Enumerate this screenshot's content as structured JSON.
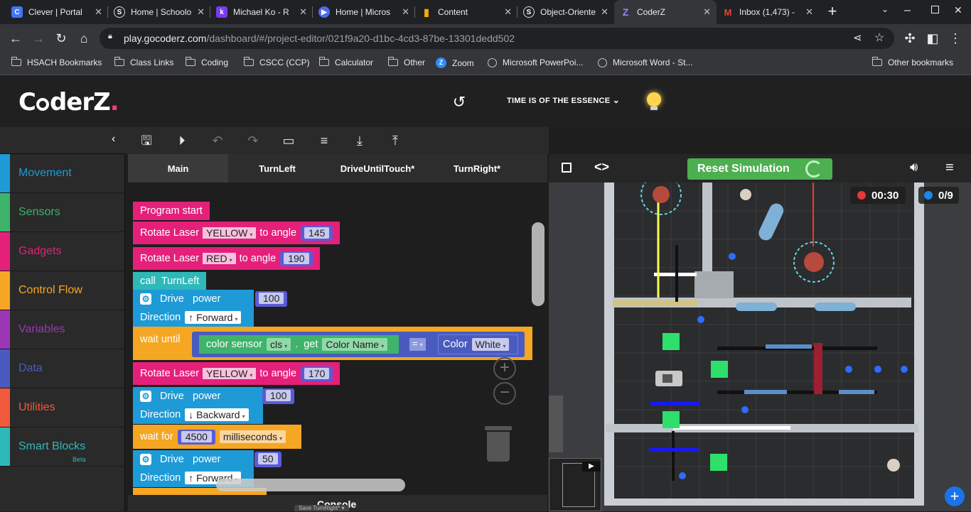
{
  "browser": {
    "tabs": [
      {
        "title": "Clever | Portal",
        "icon": "clever-favicon",
        "color": "#4274f6",
        "glyph": "C"
      },
      {
        "title": "Home | Schoolo",
        "icon": "schoology-favicon",
        "color": "#2a2a2a",
        "glyph": "S"
      },
      {
        "title": "Michael Ko - R",
        "icon": "kami-favicon",
        "color": "#7c3aed",
        "glyph": "k"
      },
      {
        "title": "Home | Micros",
        "icon": "copilot-favicon",
        "color": "#4f6bed",
        "glyph": "▶"
      },
      {
        "title": "Content",
        "icon": "chart-favicon",
        "color": "#2a2a2a",
        "glyph": "▮"
      },
      {
        "title": "Object-Oriente",
        "icon": "schoology-favicon",
        "color": "#2a2a2a",
        "glyph": "S"
      },
      {
        "title": "CoderZ",
        "icon": "coderz-favicon",
        "color": "#2a2a2a",
        "glyph": "Z"
      },
      {
        "title": "Inbox (1,473) -",
        "icon": "gmail-favicon",
        "color": "#2a2a2a",
        "glyph": "M"
      }
    ],
    "url_host": "play.gocoderz.com",
    "url_path": "/dashboard/#/project-editor/021f9a20-d1bc-4cd3-87be-13301dedd502",
    "bookmarks": [
      {
        "label": "HSACH Bookmarks",
        "type": "folder"
      },
      {
        "label": "Class Links",
        "type": "folder"
      },
      {
        "label": "Coding",
        "type": "folder"
      },
      {
        "label": "CSCC (CCP)",
        "type": "folder"
      },
      {
        "label": "Calculator",
        "type": "folder"
      },
      {
        "label": "Other",
        "type": "folder"
      },
      {
        "label": "Zoom",
        "type": "zoom"
      },
      {
        "label": "Microsoft PowerPoi...",
        "type": "globe"
      },
      {
        "label": "Microsoft Word - St...",
        "type": "globe"
      }
    ],
    "other_bookmarks": "Other bookmarks"
  },
  "app": {
    "logo": "CoderZ",
    "mission_title": "TIME IS OF THE ESSENCE",
    "categories": [
      {
        "label": "Movement",
        "color": "#1e9ad6"
      },
      {
        "label": "Sensors",
        "color": "#3fb36b"
      },
      {
        "label": "Gadgets",
        "color": "#e4207b"
      },
      {
        "label": "Control Flow",
        "color": "#f5a623"
      },
      {
        "label": "Variables",
        "color": "#9b37b5"
      },
      {
        "label": "Data",
        "color": "#4a5bbf"
      },
      {
        "label": "Utilities",
        "color": "#f15a3b"
      },
      {
        "label": "Smart Blocks",
        "color": "#2fb8b8"
      }
    ],
    "beta_label": "Beta",
    "editor_tabs": [
      "Main",
      "TurnLeft",
      "DriveUntilTouch*",
      "TurnRight*"
    ],
    "console_label": "Console",
    "console_sub": "Save TurnRight* ▾"
  },
  "blocks": {
    "program_start": "Program start",
    "rotate1": {
      "text": "Rotate Laser",
      "color": "YELLOW",
      "mid": "to angle",
      "value": "145"
    },
    "rotate2": {
      "text": "Rotate Laser",
      "color": "RED",
      "mid": "to angle",
      "value": "190"
    },
    "call": {
      "text": "call",
      "fn": "TurnLeft"
    },
    "drive1": {
      "text": "Drive",
      "power": "power",
      "value": "100",
      "dir_label": "Direction",
      "dir": "↑ Forward"
    },
    "wait_until": {
      "text": "wait until",
      "sensor": "color sensor",
      "port": "cls",
      "dot": ".",
      "get": "get",
      "prop": "Color Name",
      "op": "=",
      "color_label": "Color",
      "color_value": "White"
    },
    "rotate3": {
      "text": "Rotate Laser",
      "color": "YELLOW",
      "mid": "to angle",
      "value": "170"
    },
    "drive2": {
      "text": "Drive",
      "power": "power",
      "value": "100",
      "dir_label": "Direction",
      "dir": "↓ Backward"
    },
    "wait_for": {
      "text": "wait for",
      "value": "4500",
      "unit": "milliseconds"
    },
    "drive3": {
      "text": "Drive",
      "power": "power",
      "value": "50",
      "dir_label": "Direction",
      "dir": "↑ Forward"
    }
  },
  "simulation": {
    "reset_label": "Reset Simulation",
    "timer": "00:30",
    "score": "0/9",
    "accent_green": "#4caf50"
  }
}
